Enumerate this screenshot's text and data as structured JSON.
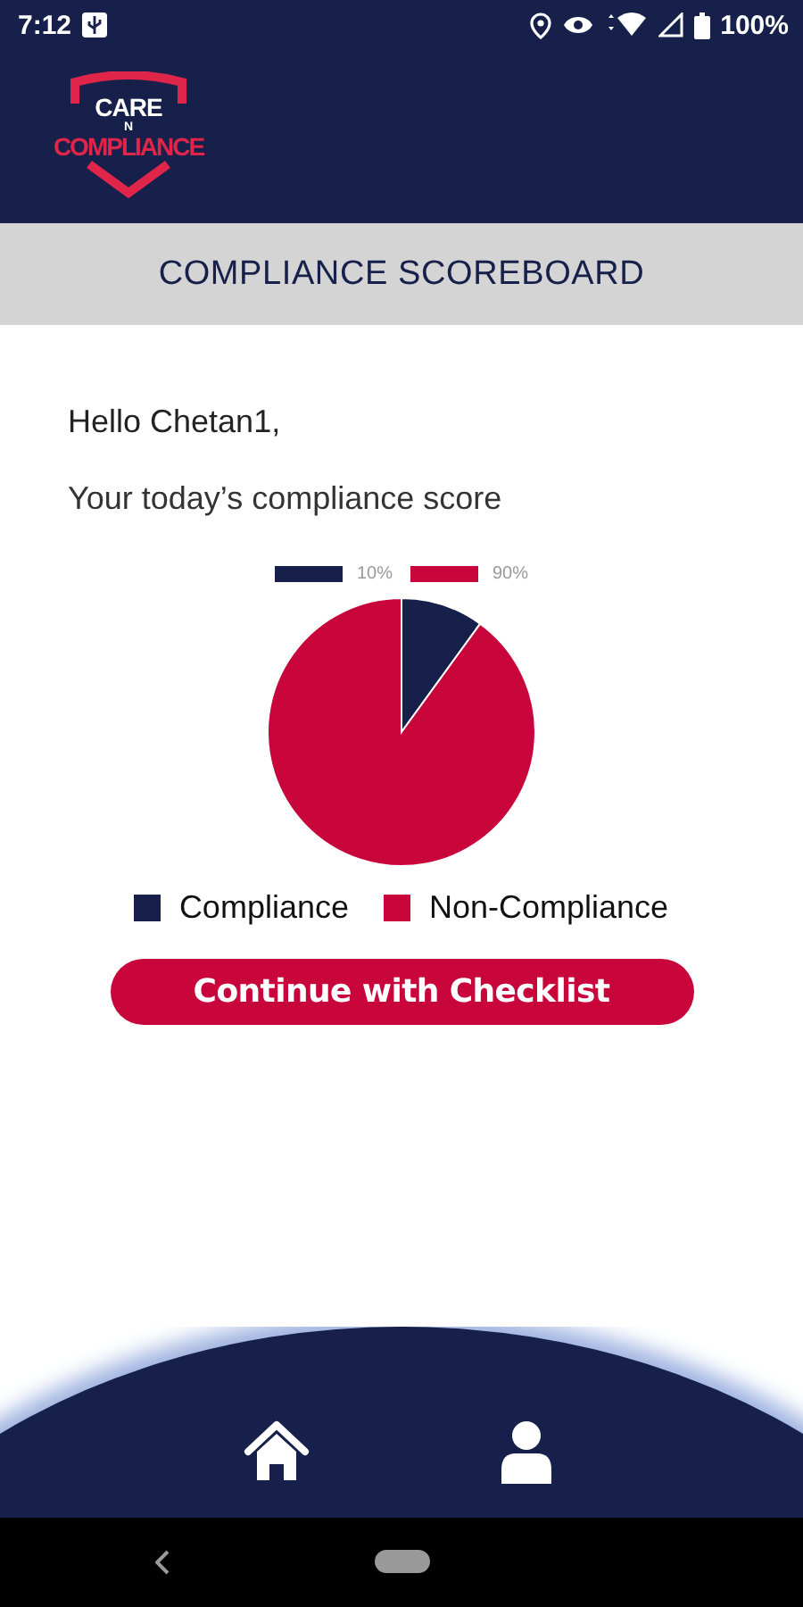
{
  "status_bar": {
    "time": "7:12",
    "battery": "100%"
  },
  "logo": {
    "line_1": "CARE",
    "line_2": "N",
    "line_3": "COMPLIANCE"
  },
  "title": "COMPLIANCE SCOREBOARD",
  "greeting": "Hello Chetan1,",
  "subtitle": "Your today’s compliance score",
  "chart_data": {
    "type": "pie",
    "categories": [
      "Compliance",
      "Non-Compliance"
    ],
    "value_labels": [
      "10%",
      "90%"
    ],
    "values": [
      10,
      90
    ],
    "legend": "bottom",
    "colors": [
      "#16204a",
      "#c8063c"
    ]
  },
  "button": "Continue with Checklist",
  "bottom_nav": [
    {
      "kind": "home"
    },
    {
      "kind": "profile"
    }
  ]
}
